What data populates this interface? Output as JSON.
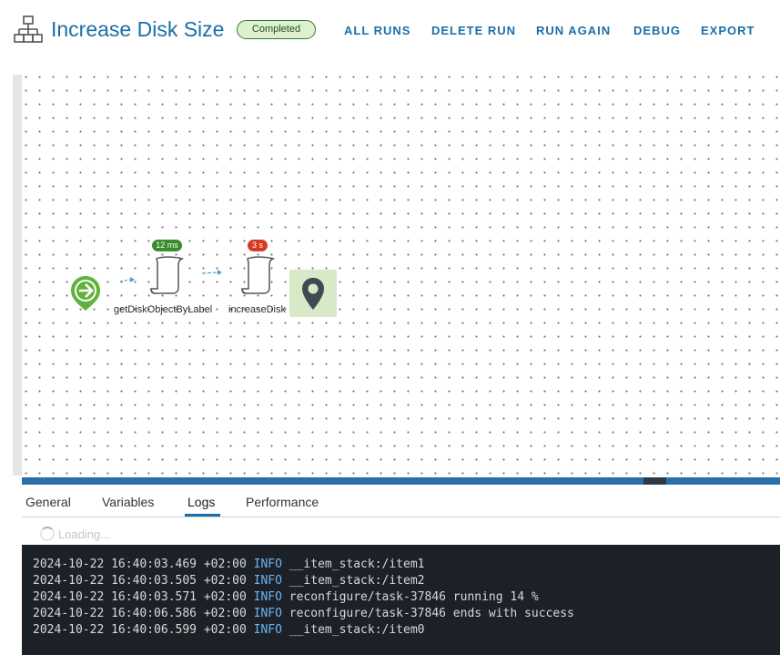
{
  "header": {
    "title": "Increase Disk Size",
    "status": "Completed",
    "actions": [
      "ALL RUNS",
      "DELETE RUN",
      "RUN AGAIN",
      "DEBUG",
      "EXPORT"
    ]
  },
  "workflow": {
    "nodes": [
      {
        "label": "getDiskObjectByLabel",
        "timing": "12 ms",
        "timing_color": "#3a8a2e"
      },
      {
        "label": "increaseDisk",
        "timing": "3 s",
        "timing_color": "#d63a25"
      }
    ]
  },
  "tabs": {
    "items": [
      "General",
      "Variables",
      "Logs",
      "Performance"
    ],
    "active": "Logs"
  },
  "logs": {
    "loading_text": "Loading...",
    "lines": [
      {
        "ts": "2024-10-22 16:40:03.469 +02:00",
        "level": "INFO",
        "msg": "__item_stack:/item1"
      },
      {
        "ts": "2024-10-22 16:40:03.505 +02:00",
        "level": "INFO",
        "msg": "__item_stack:/item2"
      },
      {
        "ts": "2024-10-22 16:40:03.571 +02:00",
        "level": "INFO",
        "msg": "reconfigure/task-37846 running 14 %"
      },
      {
        "ts": "2024-10-22 16:40:06.586 +02:00",
        "level": "INFO",
        "msg": "reconfigure/task-37846 ends with success"
      },
      {
        "ts": "2024-10-22 16:40:06.599 +02:00",
        "level": "INFO",
        "msg": "__item_stack:/item0"
      }
    ]
  }
}
